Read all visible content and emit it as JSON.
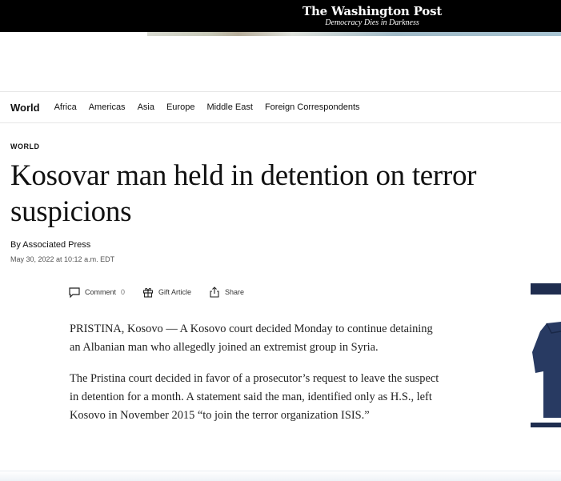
{
  "header": {
    "logo_name": "The Washington Post",
    "logo_tagline": "Democracy Dies in Darkness"
  },
  "section_nav": {
    "title": "World",
    "links": [
      "Africa",
      "Americas",
      "Asia",
      "Europe",
      "Middle East",
      "Foreign Correspondents"
    ]
  },
  "article": {
    "kicker": "WORLD",
    "headline_line1": "Kosovar man held in detention on terror",
    "headline_line2": "suspicions",
    "byline_prefix": "By",
    "author": "Associated Press",
    "date": "May 30, 2022 at 10:12 a.m. EDT",
    "paragraphs": [
      "PRISTINA, Kosovo — A Kosovo court decided Monday to continue detaining an Albanian man who allegedly joined an extremist group in Syria.",
      "The Pristina court decided in favor of a prosecutor’s request to leave the suspect in detention for a month. A statement said the man, identified only as H.S., left Kosovo in November 2015 “to join the terror organization ISIS.”"
    ]
  },
  "actions": {
    "comment_label": "Comment",
    "comment_count": "0",
    "gift_label": "Gift Article",
    "share_label": "Share"
  },
  "colors": {
    "topbar": "#000000",
    "text": "#111111",
    "image_frame": "#1f2d4f"
  }
}
